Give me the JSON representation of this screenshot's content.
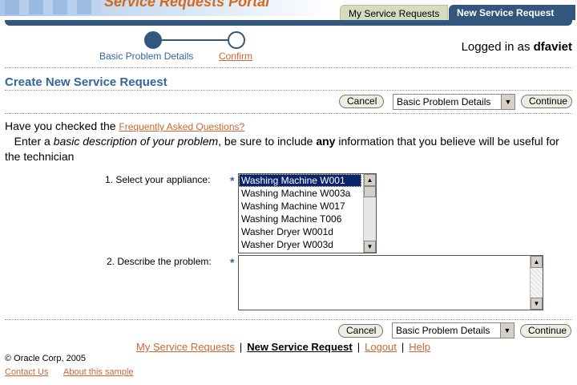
{
  "header": {
    "portal_title": "Service Requests Portal",
    "tabs": [
      {
        "label": "My Service Requests",
        "active": false
      },
      {
        "label": "New Service Request",
        "active": true
      }
    ],
    "colors": {
      "accent": "#33577c",
      "link": "#cc6633",
      "title": "#336699"
    }
  },
  "train": {
    "steps": [
      {
        "label": "Basic Problem Details",
        "current": true
      },
      {
        "label": "Confirm",
        "current": false
      }
    ]
  },
  "user": {
    "prefix": "Logged in as",
    "name": "dfaviet"
  },
  "page": {
    "title": "Create New Service Request"
  },
  "toolbar": {
    "cancel_label": "Cancel",
    "step_select_value": "Basic Problem Details",
    "continue_label": "Continue"
  },
  "intro": {
    "faq_prefix": "Have you checked the",
    "faq_link": "Frequently Asked Questions?",
    "desc_1": "Enter a",
    "desc_em": "basic description of your problem",
    "desc_2": ", be sure to include",
    "desc_strong": "any",
    "desc_3": "information that you believe will be useful for the technician"
  },
  "form": {
    "appliance_label": "1. Select your appliance:",
    "appliances": [
      "Washing Machine W001",
      "Washing Machine W003a",
      "Washing Machine W017",
      "Washing Machine T006",
      "Washer Dryer W001d",
      "Washer Dryer W003d"
    ],
    "selected_appliance": "Washing Machine W001",
    "problem_label": "2. Describe the problem:",
    "problem_value": "",
    "required_marker": "*"
  },
  "footer": {
    "links": [
      "My Service Requests",
      "New Service Request",
      "Logout",
      "Help"
    ],
    "current_link": "New Service Request",
    "separator": "|",
    "copyright": "© Oracle Corp, 2005",
    "contact": "Contact Us",
    "about": "About this sample"
  },
  "icons": {
    "select_arrow": "chevron-down-icon",
    "scroll_up": "arrow-up-icon",
    "scroll_down": "arrow-down-icon"
  }
}
